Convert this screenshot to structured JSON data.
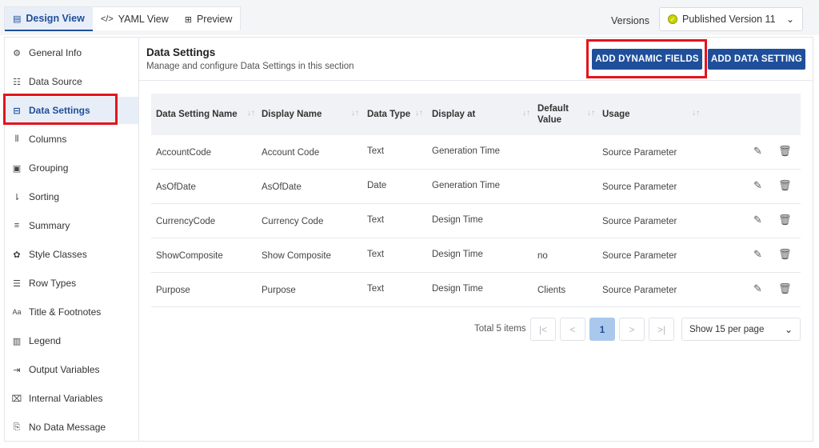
{
  "tabs": [
    {
      "label": "Design View",
      "icon": "document-icon"
    },
    {
      "label": "YAML View",
      "icon": "code-icon"
    },
    {
      "label": "Preview",
      "icon": "preview-icon"
    }
  ],
  "versions": {
    "label": "Versions",
    "selected": "Published Version 11"
  },
  "sidebar": {
    "items": [
      {
        "label": "General Info",
        "icon": "gear-icon"
      },
      {
        "label": "Data Source",
        "icon": "database-icon"
      },
      {
        "label": "Data Settings",
        "icon": "data-settings-icon"
      },
      {
        "label": "Columns",
        "icon": "columns-icon"
      },
      {
        "label": "Grouping",
        "icon": "grouping-icon"
      },
      {
        "label": "Sorting",
        "icon": "sort-icon"
      },
      {
        "label": "Summary",
        "icon": "summary-icon"
      },
      {
        "label": "Style Classes",
        "icon": "palette-icon"
      },
      {
        "label": "Row Types",
        "icon": "row-types-icon"
      },
      {
        "label": "Title & Footnotes",
        "icon": "text-icon"
      },
      {
        "label": "Legend",
        "icon": "legend-icon"
      },
      {
        "label": "Output Variables",
        "icon": "export-icon"
      },
      {
        "label": "Internal Variables",
        "icon": "variable-icon"
      },
      {
        "label": "No Data Message",
        "icon": "message-icon"
      }
    ]
  },
  "main": {
    "title": "Data Settings",
    "subtitle": "Manage and configure Data Settings in this section",
    "add_dynamic_label": "ADD DYNAMIC FIELDS",
    "add_setting_label": "ADD DATA SETTING"
  },
  "table": {
    "headers": {
      "name": "Data Setting Name",
      "display": "Display Name",
      "type": "Data Type",
      "display_at": "Display at",
      "default_1": "Default",
      "default_2": "Value",
      "usage": "Usage"
    },
    "rows": [
      {
        "name": "AccountCode",
        "display": "Account Code",
        "type": "Text",
        "display_at": "Generation Time",
        "default": "",
        "usage": "Source Parameter"
      },
      {
        "name": "AsOfDate",
        "display": "AsOfDate",
        "type": "Date",
        "display_at": "Generation Time",
        "default": "",
        "usage": "Source Parameter"
      },
      {
        "name": "CurrencyCode",
        "display": "Currency Code",
        "type": "Text",
        "display_at": "Design Time",
        "default": "",
        "usage": "Source Parameter"
      },
      {
        "name": "ShowComposite",
        "display": "Show Composite",
        "type": "Text",
        "display_at": "Design Time",
        "default": "no",
        "usage": "Source Parameter"
      },
      {
        "name": "Purpose",
        "display": "Purpose",
        "type": "Text",
        "display_at": "Design Time",
        "default": "Clients",
        "usage": "Source Parameter"
      }
    ]
  },
  "pagination": {
    "total": "Total 5 items",
    "current_page": "1",
    "per_page": "Show 15 per page"
  },
  "colors": {
    "accent": "#1f4f9a",
    "highlight": "#e3151c",
    "status_dot": "#c8d400"
  }
}
